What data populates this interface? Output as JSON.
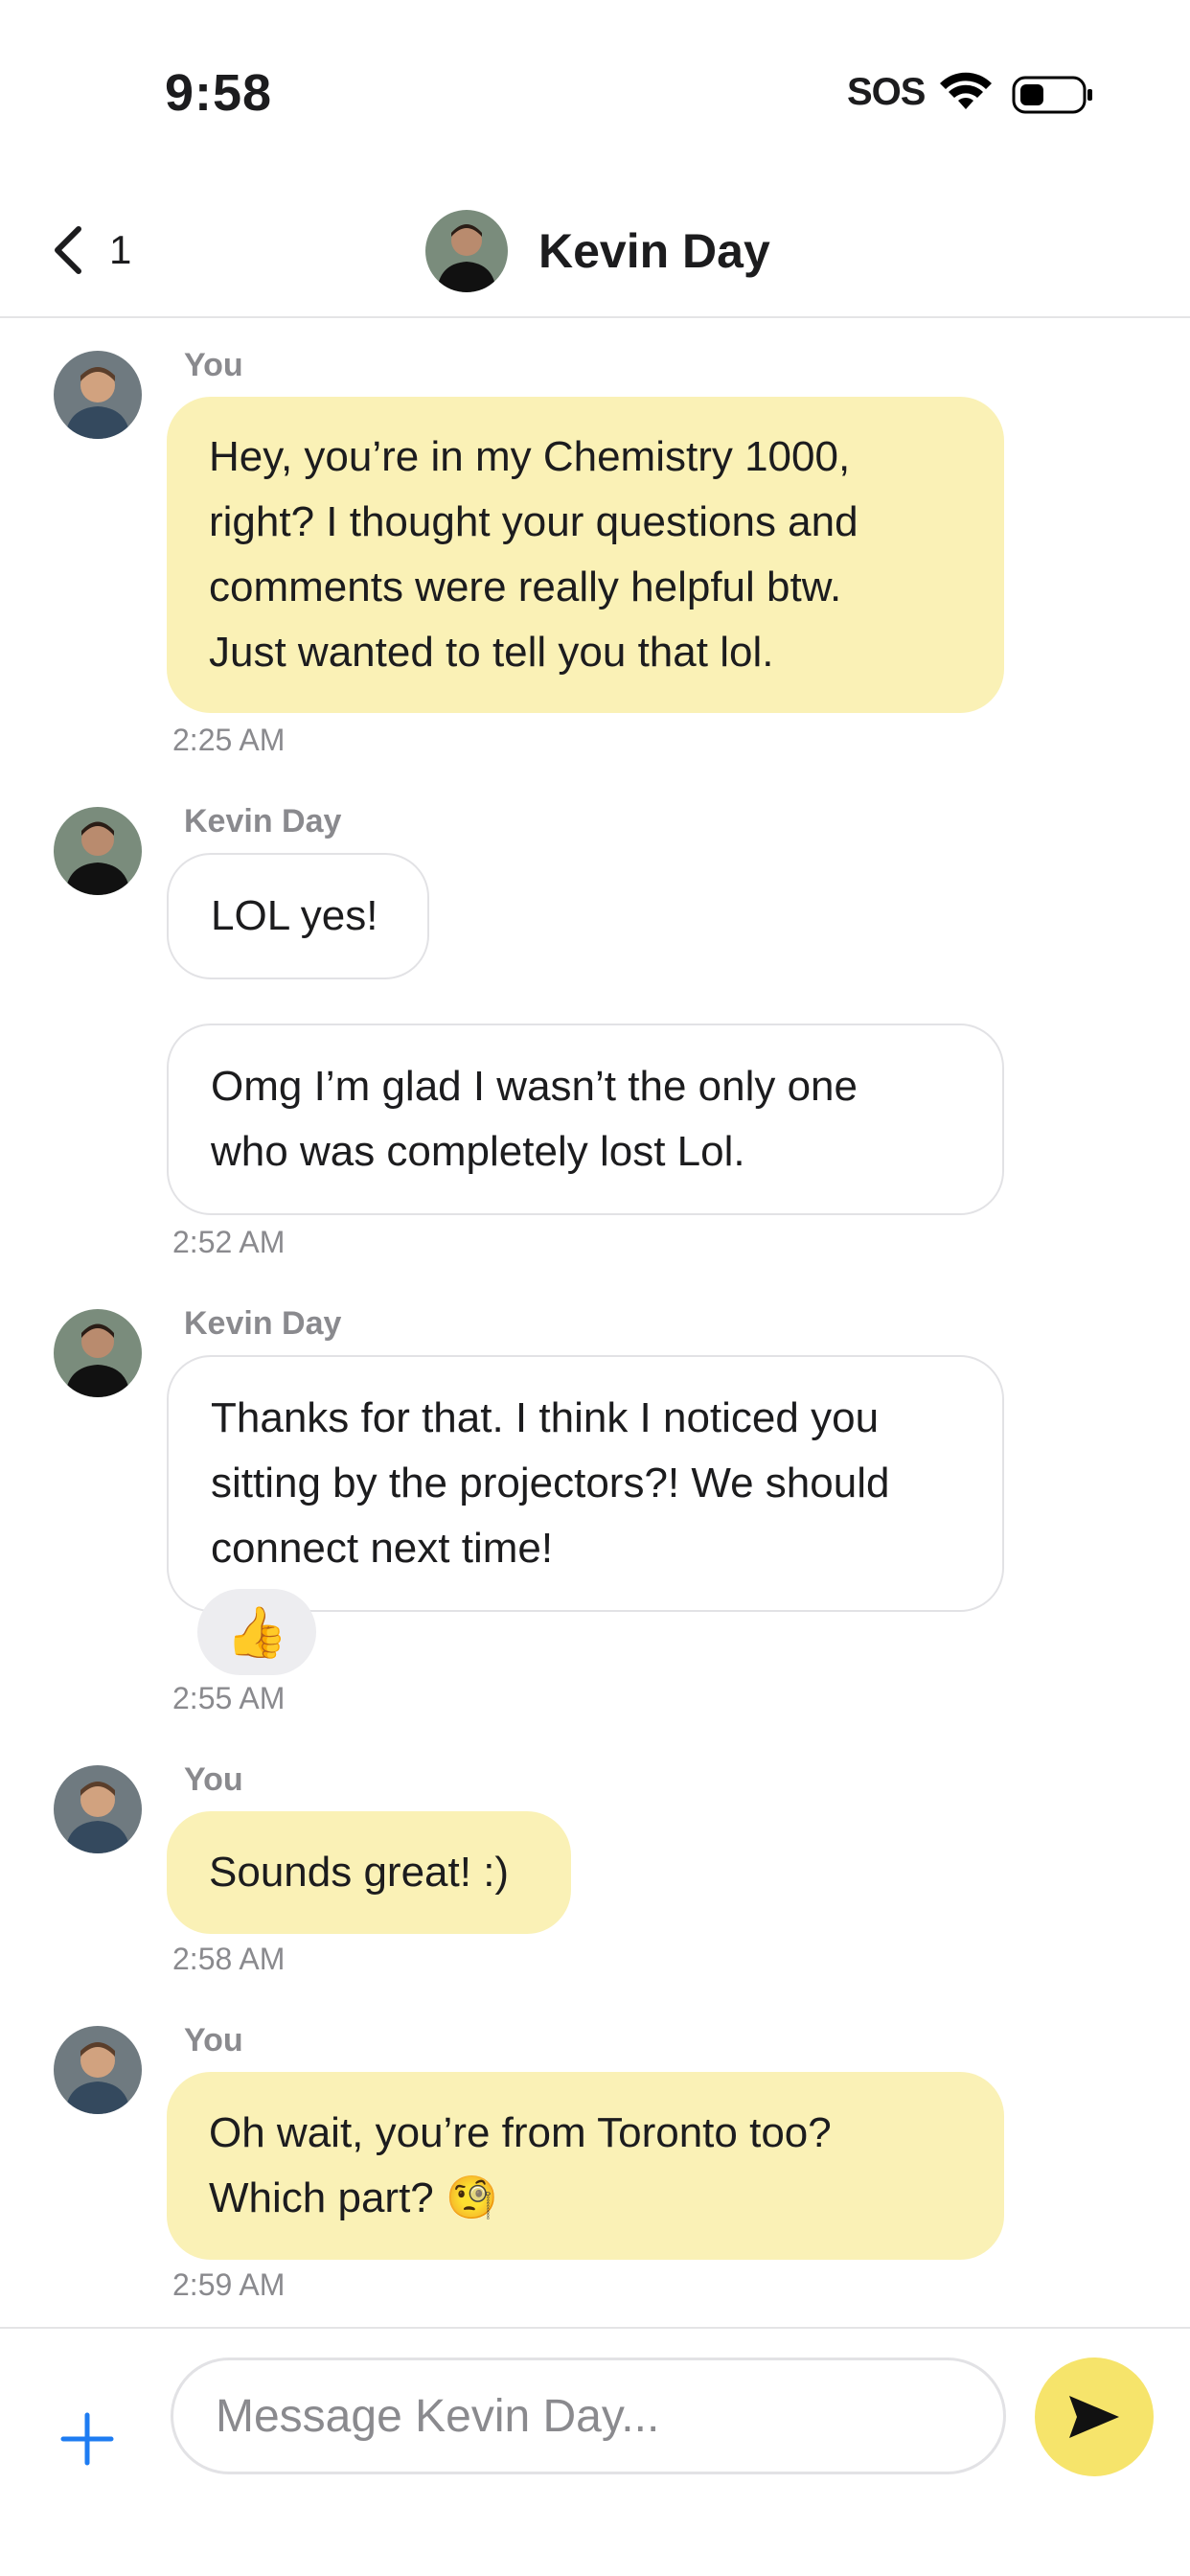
{
  "status_bar": {
    "time": "9:58",
    "carrier": "SOS"
  },
  "header": {
    "back_count": "1",
    "contact_name": "Kevin Day"
  },
  "messages": [
    {
      "sender": "You",
      "text_lines": [
        "Hey, you’re in my Chemistry 1000,",
        "right? I thought your questions and",
        "comments were really helpful btw.",
        "Just wanted to tell you that lol."
      ],
      "time": "2:25 AM"
    },
    {
      "sender": "Kevin Day",
      "text": "LOL yes!"
    },
    {
      "text_lines": [
        "Omg I’m glad I wasn’t the only one",
        "who was completely lost Lol."
      ],
      "time": "2:52 AM"
    },
    {
      "sender": "Kevin Day",
      "text_lines": [
        "Thanks for that. I think I noticed you",
        "sitting by the projectors?! We should",
        "connect next time!"
      ],
      "reaction": "👍",
      "time": "2:55 AM"
    },
    {
      "sender": "You",
      "text": "Sounds great! :)",
      "time": "2:58 AM"
    },
    {
      "sender": "You",
      "text_lines": [
        "Oh wait, you’re from Toronto too?",
        "Which part? 🧐"
      ],
      "time": "2:59 AM"
    }
  ],
  "composer": {
    "placeholder": "Message Kevin Day..."
  },
  "icons": {
    "back": "chevron-left-icon",
    "plus": "plus-icon",
    "send": "send-icon",
    "wifi": "wifi-icon",
    "battery": "battery-icon"
  },
  "colors": {
    "my_bubble": "#faf1b6",
    "their_bubble_border": "#e2e2e5",
    "send_button": "#f6e46b",
    "accent_blue": "#1e7cf2"
  }
}
